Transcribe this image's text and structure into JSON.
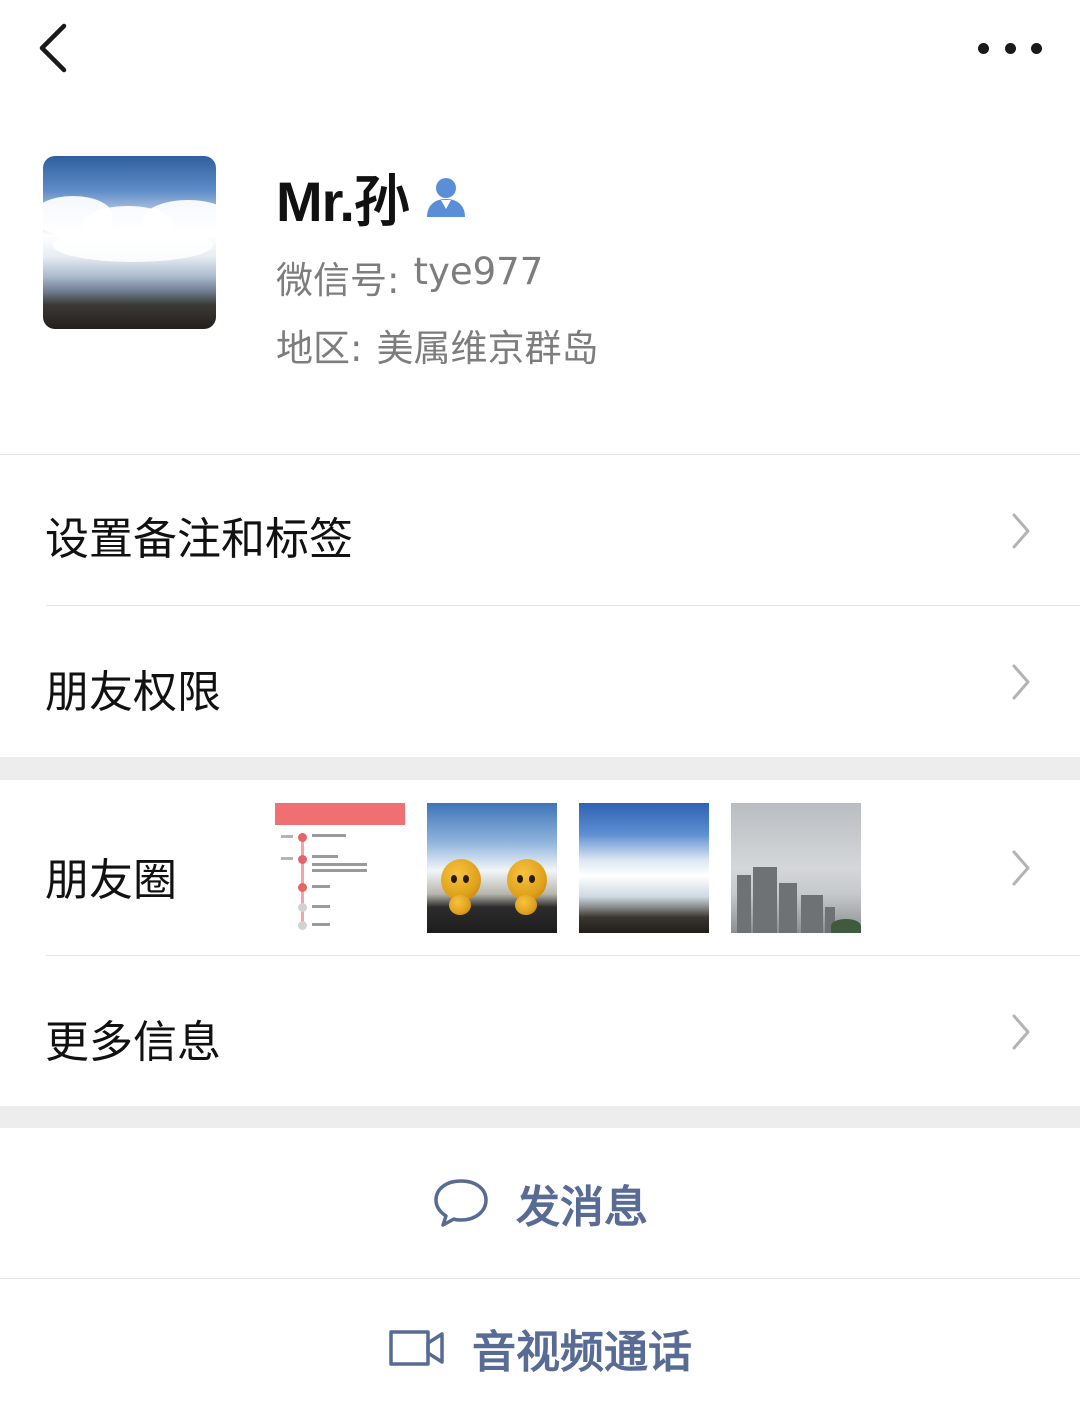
{
  "nav": {
    "back_icon": "chevron-left-icon",
    "more_icon": "more-dots-icon"
  },
  "profile": {
    "name": "Mr.孙",
    "friend_icon": "person-icon",
    "wechat_id_label": "微信号:",
    "wechat_id": "tye977",
    "region_label": "地区:",
    "region": "美属维京群岛"
  },
  "menu": {
    "remark_tags": "设置备注和标签",
    "permissions": "朋友权限",
    "moments": "朋友圈",
    "more_info": "更多信息"
  },
  "actions": {
    "message": "发消息",
    "message_icon": "chat-bubble-icon",
    "call": "音视频通话",
    "call_icon": "video-camera-icon"
  },
  "colors": {
    "action_text": "#576b95",
    "friend_icon": "#5a8fd8",
    "secondary_text": "#7d7d7d",
    "section_gap": "#ededed"
  }
}
